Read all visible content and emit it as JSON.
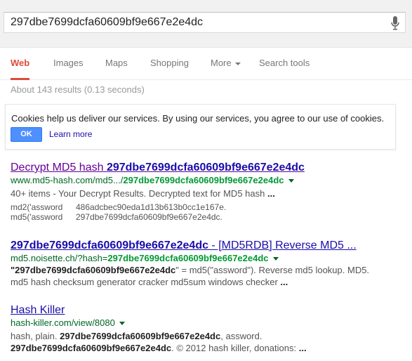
{
  "search": {
    "query": "297dbe7699dcfa60609bf9e667e2e4dc",
    "icon": "microphone-icon"
  },
  "tabs": [
    {
      "label": "Web",
      "active": true
    },
    {
      "label": "Images"
    },
    {
      "label": "Maps"
    },
    {
      "label": "Shopping"
    },
    {
      "label": "More"
    },
    {
      "label": "Search tools"
    }
  ],
  "stats": "About 143 results (0.13 seconds)",
  "cookie": {
    "message": "Cookies help us deliver our services. By using our services, you agree to our use of cookies.",
    "ok": "OK",
    "learn_more": "Learn more"
  },
  "colors": {
    "accent": "#dd4b39",
    "link": "#1a0dab",
    "url": "#006621",
    "button": "#4d90fe"
  },
  "results": [
    {
      "title_pre": "Decrypt MD5 hash ",
      "title_bold": "297dbe7699dcfa60609bf9e667e2e4dc",
      "title_post": "",
      "url_pre": "www.md5-hash.com/md5.../",
      "url_bold": "297dbe7699dcfa60609bf9e667e2e4dc",
      "snippet": "40+ items - Your Decrypt Results. Decrypted text for MD5 hash ",
      "snippet_end": "...",
      "rows": [
        {
          "k": "md2('assword",
          "v": "486adcbec90eda1d13b613b0cc1e167e."
        },
        {
          "k": "md5('assword",
          "v": "297dbe7699dcfa60609bf9e667e2e4dc."
        }
      ]
    },
    {
      "title_pre": "",
      "title_bold": "297dbe7699dcfa60609bf9e667e2e4dc",
      "title_post": " - [MD5RDB] Reverse MD5 ...",
      "url_pre": "md5.noisette.ch/?hash=",
      "url_bold": "297dbe7699dcfa60609bf9e667e2e4dc",
      "line1_a": "\"",
      "line1_b": "297dbe7699dcfa60609bf9e667e2e4dc",
      "line1_c": "\" = md5(\"assword\"). Reverse md5 lookup. MD5.",
      "line2": "md5 hash checksum generator cracker md5sum windows checker ",
      "line2_end": "..."
    },
    {
      "title": "Hash Killer",
      "url": "hash-killer.com/view/8080",
      "line1_a": "hash, plain. ",
      "line1_b": "297dbe7699dcfa60609bf9e667e2e4dc",
      "line1_c": ", assword.",
      "line2_a": "297dbe7699dcfa60609bf9e667e2e4dc",
      "line2_b": ". © 2012 hash killer, donations: ",
      "line2_end": "..."
    }
  ]
}
